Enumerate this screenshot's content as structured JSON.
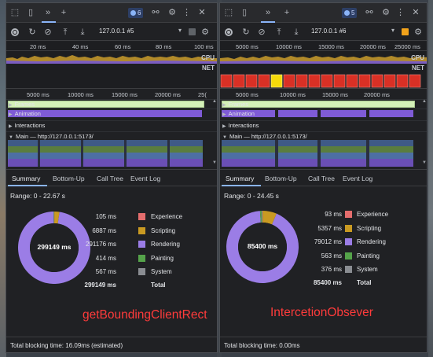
{
  "colors": {
    "experience": "#e46d6d",
    "scripting": "#c99a22",
    "rendering": "#9b7de6",
    "painting": "#55a34a",
    "system": "#8a8d92",
    "caption": "#ff3b3b"
  },
  "panels": [
    {
      "id": "left",
      "tab_badge": "6",
      "toolbar": {
        "profile": "127.0.0.1 #5",
        "checkbox_checked": false
      },
      "overview_ticks": [
        "20 ms",
        "40 ms",
        "60 ms",
        "80 ms",
        "100 ms"
      ],
      "cpu_label": "CPU",
      "net_label": "NET",
      "flame_ticks": [
        "5000 ms",
        "10000 ms",
        "15000 ms",
        "20000 ms",
        "25("
      ],
      "tracks": {
        "frames": "Frames",
        "animation": "Animation",
        "interactions": "Interactions",
        "main": "Main — http://127.0.0.1:5173/"
      },
      "detail_tabs": [
        "Summary",
        "Bottom-Up",
        "Call Tree",
        "Event Log"
      ],
      "range": "Range: 0 - 22.67 s",
      "donut_total": "299149 ms",
      "summary": [
        {
          "value": "105 ms",
          "name": "Experience",
          "key": "experience",
          "ms": 105
        },
        {
          "value": "6887 ms",
          "name": "Scripting",
          "key": "scripting",
          "ms": 6887
        },
        {
          "value": "291176 ms",
          "name": "Rendering",
          "key": "rendering",
          "ms": 291176
        },
        {
          "value": "414 ms",
          "name": "Painting",
          "key": "painting",
          "ms": 414
        },
        {
          "value": "567 ms",
          "name": "System",
          "key": "system",
          "ms": 567
        }
      ],
      "summary_total": {
        "value": "299149 ms",
        "name": "Total"
      },
      "caption": "getBoundingClientRect",
      "footer": "Total blocking time: 16.09ms (estimated)"
    },
    {
      "id": "right",
      "tab_badge": "5",
      "toolbar": {
        "profile": "127.0.0.1 #6",
        "checkbox_checked": true
      },
      "overview_ticks": [
        "5000 ms",
        "10000 ms",
        "15000 ms",
        "20000 ms",
        "25000 ms"
      ],
      "cpu_label": "CPU",
      "net_label": "NET",
      "flame_ticks": [
        "5000 ms",
        "10000 ms",
        "15000 ms",
        "20000 ms"
      ],
      "tracks": {
        "frames": "Frames",
        "animation": "Animation",
        "interactions": "Interactions",
        "main": "Main — http://127.0.0.1:5173/"
      },
      "detail_tabs": [
        "Summary",
        "Bottom-Up",
        "Call Tree",
        "Event Log"
      ],
      "range": "Range: 0 - 24.45 s",
      "donut_total": "85400 ms",
      "summary": [
        {
          "value": "93 ms",
          "name": "Experience",
          "key": "experience",
          "ms": 93
        },
        {
          "value": "5357 ms",
          "name": "Scripting",
          "key": "scripting",
          "ms": 5357
        },
        {
          "value": "79012 ms",
          "name": "Rendering",
          "key": "rendering",
          "ms": 79012
        },
        {
          "value": "563 ms",
          "name": "Painting",
          "key": "painting",
          "ms": 563
        },
        {
          "value": "376 ms",
          "name": "System",
          "key": "system",
          "ms": 376
        }
      ],
      "summary_total": {
        "value": "85400 ms",
        "name": "Total"
      },
      "caption": "IntercetionObsever",
      "footer": "Total blocking time: 0.00ms"
    }
  ]
}
